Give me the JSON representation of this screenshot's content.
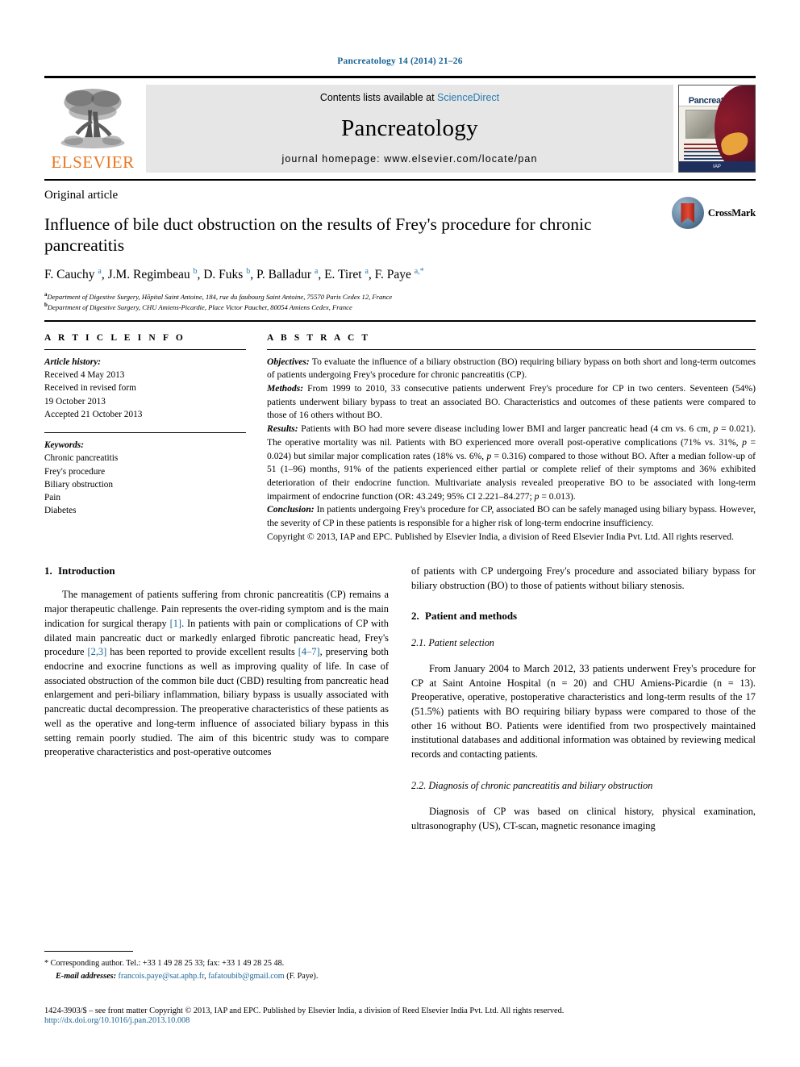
{
  "running_head": "Pancreatology 14 (2014) 21–26",
  "masthead": {
    "contents_prefix": "Contents lists available at",
    "contents_link": "ScienceDirect",
    "journal_name": "Pancreatology",
    "homepage": "journal homepage: www.elsevier.com/locate/pan",
    "publisher_word": "ELSEVIER",
    "cover_title": "Pancreatology",
    "cover_footer": "IAP",
    "link_color": "#2a7ab0",
    "publisher_color": "#E87722"
  },
  "article": {
    "type": "Original article",
    "title": "Influence of bile duct obstruction on the results of Frey's procedure for chronic pancreatitis",
    "authors_html": "F. Cauchy <sup>a</sup>, J.M. Regimbeau <sup>b</sup>, D. Fuks <sup>b</sup>, P. Balladur <sup>a</sup>, E. Tiret <sup>a</sup>, F. Paye <sup>a,*</sup>",
    "affiliations": [
      "Department of Digestive Surgery, Hôpital Saint Antoine, 184, rue du faubourg Saint Antoine, 75570 Paris Cedex 12, France",
      "Department of Digestive Surgery, CHU Amiens-Picardie, Place Victor Pauchet, 80054 Amiens Cedex, France"
    ],
    "affiliation_marks": [
      "a",
      "b"
    ],
    "crossmark_label": "CrossMark"
  },
  "article_info": {
    "heading": "A R T I C L E   I N F O",
    "history_label": "Article history:",
    "history_lines": [
      "Received 4 May 2013",
      "Received in revised form",
      "19 October 2013",
      "Accepted 21 October 2013"
    ],
    "keywords_label": "Keywords:",
    "keywords": [
      "Chronic pancreatitis",
      "Frey's procedure",
      "Biliary obstruction",
      "Pain",
      "Diabetes"
    ]
  },
  "abstract": {
    "heading": "A B S T R A C T",
    "objectives_label": "Objectives:",
    "objectives_text": " To evaluate the influence of a biliary obstruction (BO) requiring biliary bypass on both short and long-term outcomes of patients undergoing Frey's procedure for chronic pancreatitis (CP).",
    "methods_label": "Methods:",
    "methods_text": " From 1999 to 2010, 33 consecutive patients underwent Frey's procedure for CP in two centers. Seventeen (54%) patients underwent biliary bypass to treat an associated BO. Characteristics and outcomes of these patients were compared to those of 16 others without BO.",
    "results_label": "Results:",
    "results_text_1": " Patients with BO had more severe disease including lower BMI and larger pancreatic head (4 cm vs. 6 cm, ",
    "results_p1": "p",
    "results_text_2": " = 0.021). The operative mortality was nil. Patients with BO experienced more overall post-operative complications (71% vs. 31%, ",
    "results_p2": "p",
    "results_text_3": " = 0.024) but similar major complication rates (18% vs. 6%, ",
    "results_p3": "p",
    "results_text_4": " = 0.316) compared to those without BO. After a median follow-up of 51 (1–96) months, 91% of the patients experienced either partial or complete relief of their symptoms and 36% exhibited deterioration of their endocrine function. Multivariate analysis revealed preoperative BO to be associated with long-term impairment of endocrine function (OR: 43.249; 95% CI 2.221–84.277; ",
    "results_p4": "p",
    "results_text_5": " = 0.013).",
    "conclusion_label": "Conclusion:",
    "conclusion_text": " In patients undergoing Frey's procedure for CP, associated BO can be safely managed using biliary bypass. However, the severity of CP in these patients is responsible for a higher risk of long-term endocrine insufficiency.",
    "copyright": "Copyright © 2013, IAP and EPC. Published by Elsevier India, a division of Reed Elsevier India Pvt. Ltd. All rights reserved."
  },
  "sections": {
    "intro_heading_num": "1.",
    "intro_heading": "Introduction",
    "intro_p1_a": "The management of patients suffering from chronic pancreatitis (CP) remains a major therapeutic challenge. Pain represents the over-riding symptom and is the main indication for surgical therapy ",
    "intro_ref1": "[1]",
    "intro_p1_b": ". In patients with pain or complications of CP with dilated main pancreatic duct or markedly enlarged fibrotic pancreatic head, Frey's procedure ",
    "intro_ref2": "[2,3]",
    "intro_p1_c": " has been reported to provide excellent results ",
    "intro_ref3": "[4–7]",
    "intro_p1_d": ", preserving both endocrine and exocrine functions as well as improving quality of life. In case of associated obstruction of the common bile duct (CBD) resulting from pancreatic head enlargement and peri-biliary inflammation, biliary bypass is usually associated with pancreatic ductal decompression. The preoperative characteristics of these patients as well as the operative and long-term influence of associated biliary bypass in this setting remain poorly studied. The aim of this bicentric study was to compare preoperative characteristics and post-operative outcomes",
    "intro_p1_cont": "of patients with CP undergoing Frey's procedure and associated biliary bypass for biliary obstruction (BO) to those of patients without biliary stenosis.",
    "methods_heading_num": "2.",
    "methods_heading": "Patient and methods",
    "sub21_num": "2.1.",
    "sub21_heading": "Patient selection",
    "sub21_text": "From January 2004 to March 2012, 33 patients underwent Frey's procedure for CP at Saint Antoine Hospital (n = 20) and CHU Amiens-Picardie (n = 13). Preoperative, operative, postoperative characteristics and long-term results of the 17 (51.5%) patients with BO requiring biliary bypass were compared to those of the other 16 without BO. Patients were identified from two prospectively maintained institutional databases and additional information was obtained by reviewing medical records and contacting patients.",
    "sub22_num": "2.2.",
    "sub22_heading": "Diagnosis of chronic pancreatitis and biliary obstruction",
    "sub22_text": "Diagnosis of CP was based on clinical history, physical examination, ultrasonography (US), CT-scan, magnetic resonance imaging"
  },
  "footnotes": {
    "corresponding_mark": "*",
    "corresponding_text": " Corresponding author. Tel.: +33 1 49 28 25 33; fax: +33 1 49 28 25 48.",
    "email_label": "E-mail addresses:",
    "email_1": "francois.paye@sat.aphp.fr",
    "email_sep": ", ",
    "email_2": "fafatoubib@gmail.com",
    "email_suffix": " (F. Paye)."
  },
  "page_footer": {
    "issn_line": "1424-3903/$ – see front matter Copyright © 2013, IAP and EPC. Published by Elsevier India, a division of Reed Elsevier India Pvt. Ltd. All rights reserved.",
    "doi": "http://dx.doi.org/10.1016/j.pan.2013.10.008"
  }
}
